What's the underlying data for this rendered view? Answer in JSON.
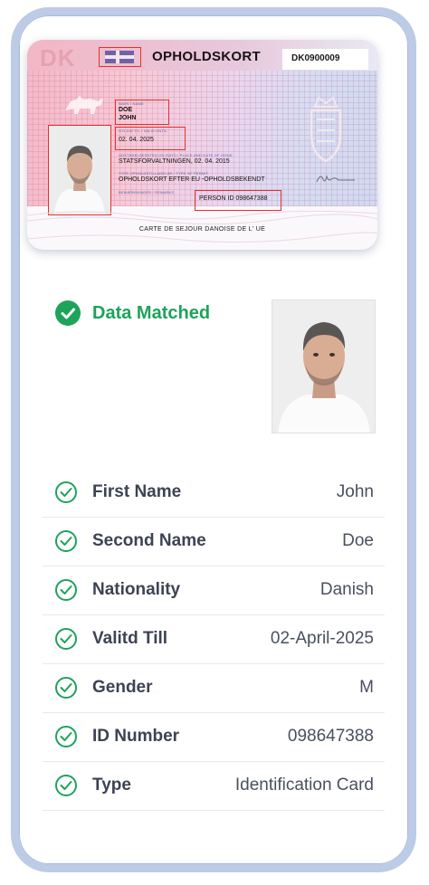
{
  "id_card": {
    "country_code": "DK",
    "title": "OPHOLDSKORT",
    "card_number": "DK0900009",
    "name_label": "NAVN / NAME",
    "surname": "DOE",
    "given_name": "JOHN",
    "valid_label": "GYLDIG TIL / VALID UNTIL",
    "valid_until": "02. 04. 2025",
    "issue_label": "UDSTEDELSESSTED OG DATO / PLACE AND DATE OF ISSUE",
    "issue_place_date": "STATSFORVALTNINGEN, 02. 04. 2015",
    "permit_label": "TYPE OPHOLDSTILLADELSE / TYPE OF PERMIT",
    "permit_type": "OPHOLDSKORT EFTER EU -OPHOLDSBEKENDT",
    "remarks_label": "BEMÆRKNINGER / REMARKS",
    "person_id": "PERSON ID 098647388",
    "footer": "CARTE DE SEJOUR DANOISE DE L' UE"
  },
  "match": {
    "status": "Data Matched",
    "status_color": "#1da35a"
  },
  "fields": [
    {
      "label": "First Name",
      "value": "John"
    },
    {
      "label": "Second Name",
      "value": "Doe"
    },
    {
      "label": "Nationality",
      "value": "Danish"
    },
    {
      "label": "Valitd Till",
      "value": "02-April-2025"
    },
    {
      "label": "Gender",
      "value": "M"
    },
    {
      "label": "ID Number",
      "value": "098647388"
    },
    {
      "label": "Type",
      "value": "Identification Card"
    }
  ],
  "icons": {
    "status": "check-circle-filled-icon",
    "row": "check-circle-outline-icon"
  }
}
